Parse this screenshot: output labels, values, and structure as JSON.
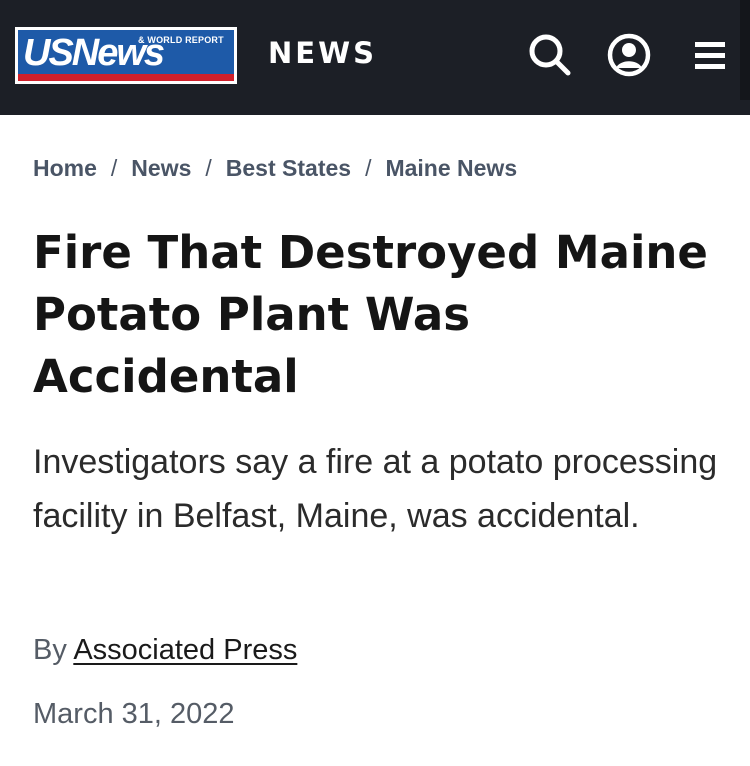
{
  "header": {
    "logo_main": "USNews",
    "logo_sub": "& WORLD REPORT",
    "section": "NEWS",
    "icons": [
      "search-icon",
      "account-icon",
      "menu-icon"
    ],
    "colors": {
      "bar": "#1c1f26",
      "logo_blue": "#1e5aa8",
      "logo_red": "#d0202b"
    }
  },
  "breadcrumb": {
    "items": [
      "Home",
      "News",
      "Best States",
      "Maine News"
    ],
    "separator": "/"
  },
  "article": {
    "headline": "Fire That Destroyed Maine Potato Plant Was Accidental",
    "dek": "Investigators say a fire at a potato processing facility in Belfast, Maine, was accidental.",
    "byline_prefix": "By",
    "author": "Associated Press",
    "date": "March 31, 2022"
  }
}
